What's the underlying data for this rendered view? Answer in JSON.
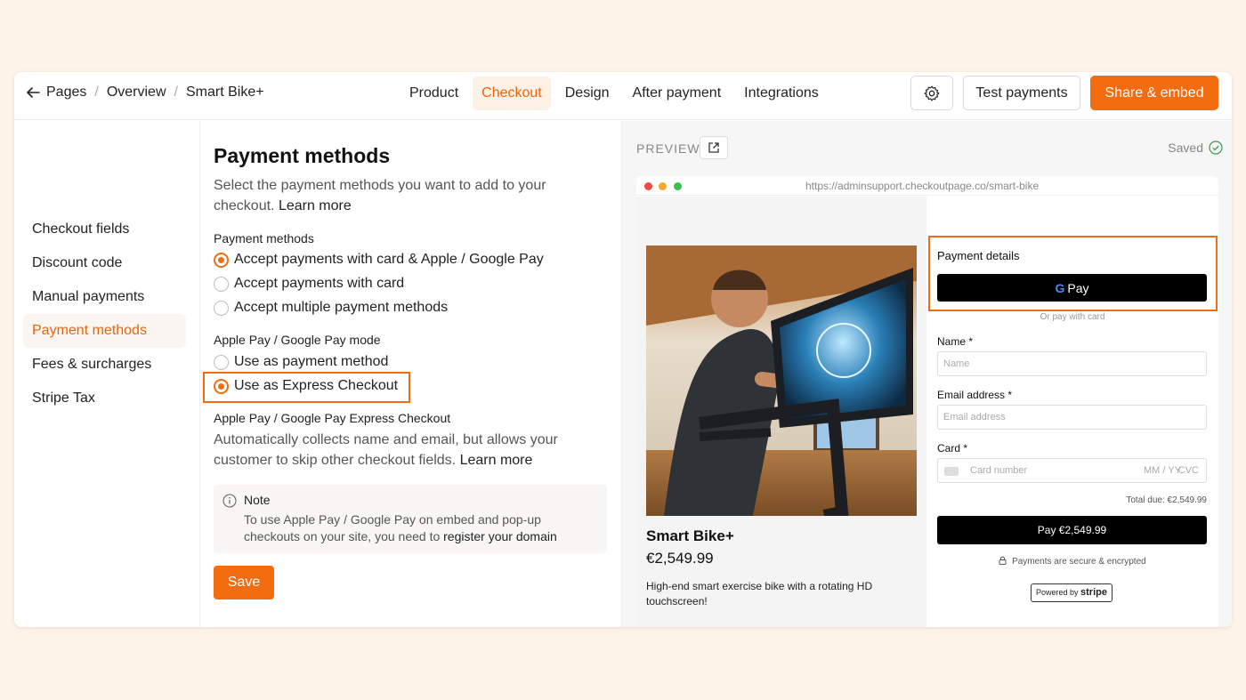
{
  "breadcrumb": {
    "items": [
      "Pages",
      "Overview",
      "Smart Bike+"
    ],
    "separator": "/"
  },
  "tabs": [
    {
      "label": "Product",
      "active": false
    },
    {
      "label": "Checkout",
      "active": true
    },
    {
      "label": "Design",
      "active": false
    },
    {
      "label": "After payment",
      "active": false
    },
    {
      "label": "Integrations",
      "active": false
    }
  ],
  "toolbar": {
    "test_label": "Test payments",
    "share_label": "Share & embed"
  },
  "sidebar": {
    "items": [
      {
        "label": "Checkout fields",
        "active": false
      },
      {
        "label": "Discount code",
        "active": false
      },
      {
        "label": "Manual payments",
        "active": false
      },
      {
        "label": "Payment methods",
        "active": true
      },
      {
        "label": "Fees & surcharges",
        "active": false
      },
      {
        "label": "Stripe Tax",
        "active": false
      }
    ]
  },
  "main": {
    "title": "Payment methods",
    "intro": "Select the payment methods you want to add to your checkout.",
    "intro_link": "Learn more",
    "methods_label": "Payment methods",
    "methods": [
      {
        "label": "Accept payments with card & Apple / Google Pay",
        "selected": true
      },
      {
        "label": "Accept payments with card",
        "selected": false
      },
      {
        "label": "Accept multiple payment methods",
        "selected": false
      }
    ],
    "mode_label": "Apple Pay / Google Pay mode",
    "modes": [
      {
        "label": "Use as payment method",
        "selected": false
      },
      {
        "label": "Use as Express Checkout",
        "selected": true
      }
    ],
    "express_label": "Apple Pay / Google Pay Express Checkout",
    "express_desc": "Automatically collects name and email, but allows your customer to skip other checkout fields.",
    "express_link": "Learn more",
    "note": {
      "title": "Note",
      "body": "To use Apple Pay / Google Pay on embed and pop-up checkouts on your site, you need to",
      "link": "register your domain"
    },
    "save_label": "Save"
  },
  "preview": {
    "label": "PREVIEW",
    "saved_label": "Saved",
    "url": "https://adminsupport.checkoutpage.co/smart-bike",
    "product": {
      "name": "Smart Bike+",
      "price": "€2,549.99",
      "description": "High-end smart exercise bike with a rotating HD touchscreen!"
    },
    "payment": {
      "title": "Payment details",
      "gpay_g": "G",
      "gpay_label": "Pay",
      "or_card": "Or pay with card",
      "name_label": "Name *",
      "name_placeholder": "Name",
      "email_label": "Email address *",
      "email_placeholder": "Email address",
      "card_label": "Card *",
      "card_placeholder": "Card number",
      "card_expiry": "MM / YY",
      "card_cvc": "CVC",
      "total": "Total due: €2,549.99",
      "pay_button": "Pay €2,549.99",
      "secure": "Payments are secure & encrypted",
      "powered_by": "Powered by",
      "powered_brand": "stripe"
    }
  },
  "colors": {
    "accent": "#f36c10",
    "background": "#fdf3e9"
  }
}
